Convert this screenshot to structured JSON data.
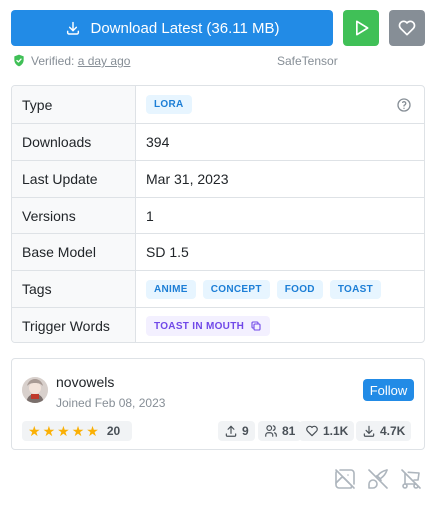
{
  "actions": {
    "download_label": "Download Latest (36.11 MB)",
    "colors": {
      "download": "#228be6",
      "play": "#40c057",
      "like": "#868e96"
    }
  },
  "verification": {
    "prefix": "Verified:",
    "time": "a day ago",
    "format": "SafeTensor"
  },
  "details": {
    "rows": [
      {
        "label": "Type",
        "value": "LORA"
      },
      {
        "label": "Downloads",
        "value": "394"
      },
      {
        "label": "Last Update",
        "value": "Mar 31, 2023"
      },
      {
        "label": "Versions",
        "value": "1"
      },
      {
        "label": "Base Model",
        "value": "SD 1.5"
      },
      {
        "label": "Tags",
        "value": ""
      },
      {
        "label": "Trigger Words",
        "value": "TOAST IN MOUTH"
      }
    ],
    "tags": [
      "ANIME",
      "CONCEPT",
      "FOOD",
      "TOAST"
    ]
  },
  "creator": {
    "name": "novowels",
    "joined": "Joined Feb 08, 2023",
    "follow_label": "Follow",
    "rating_stars": 5,
    "rating_count": "20",
    "uploads": "9",
    "followers": "81",
    "favorites": "1.1K",
    "downloads": "4.7K"
  },
  "bottom_icons": [
    "image-off-icon",
    "brush-off-icon",
    "cart-off-icon"
  ]
}
